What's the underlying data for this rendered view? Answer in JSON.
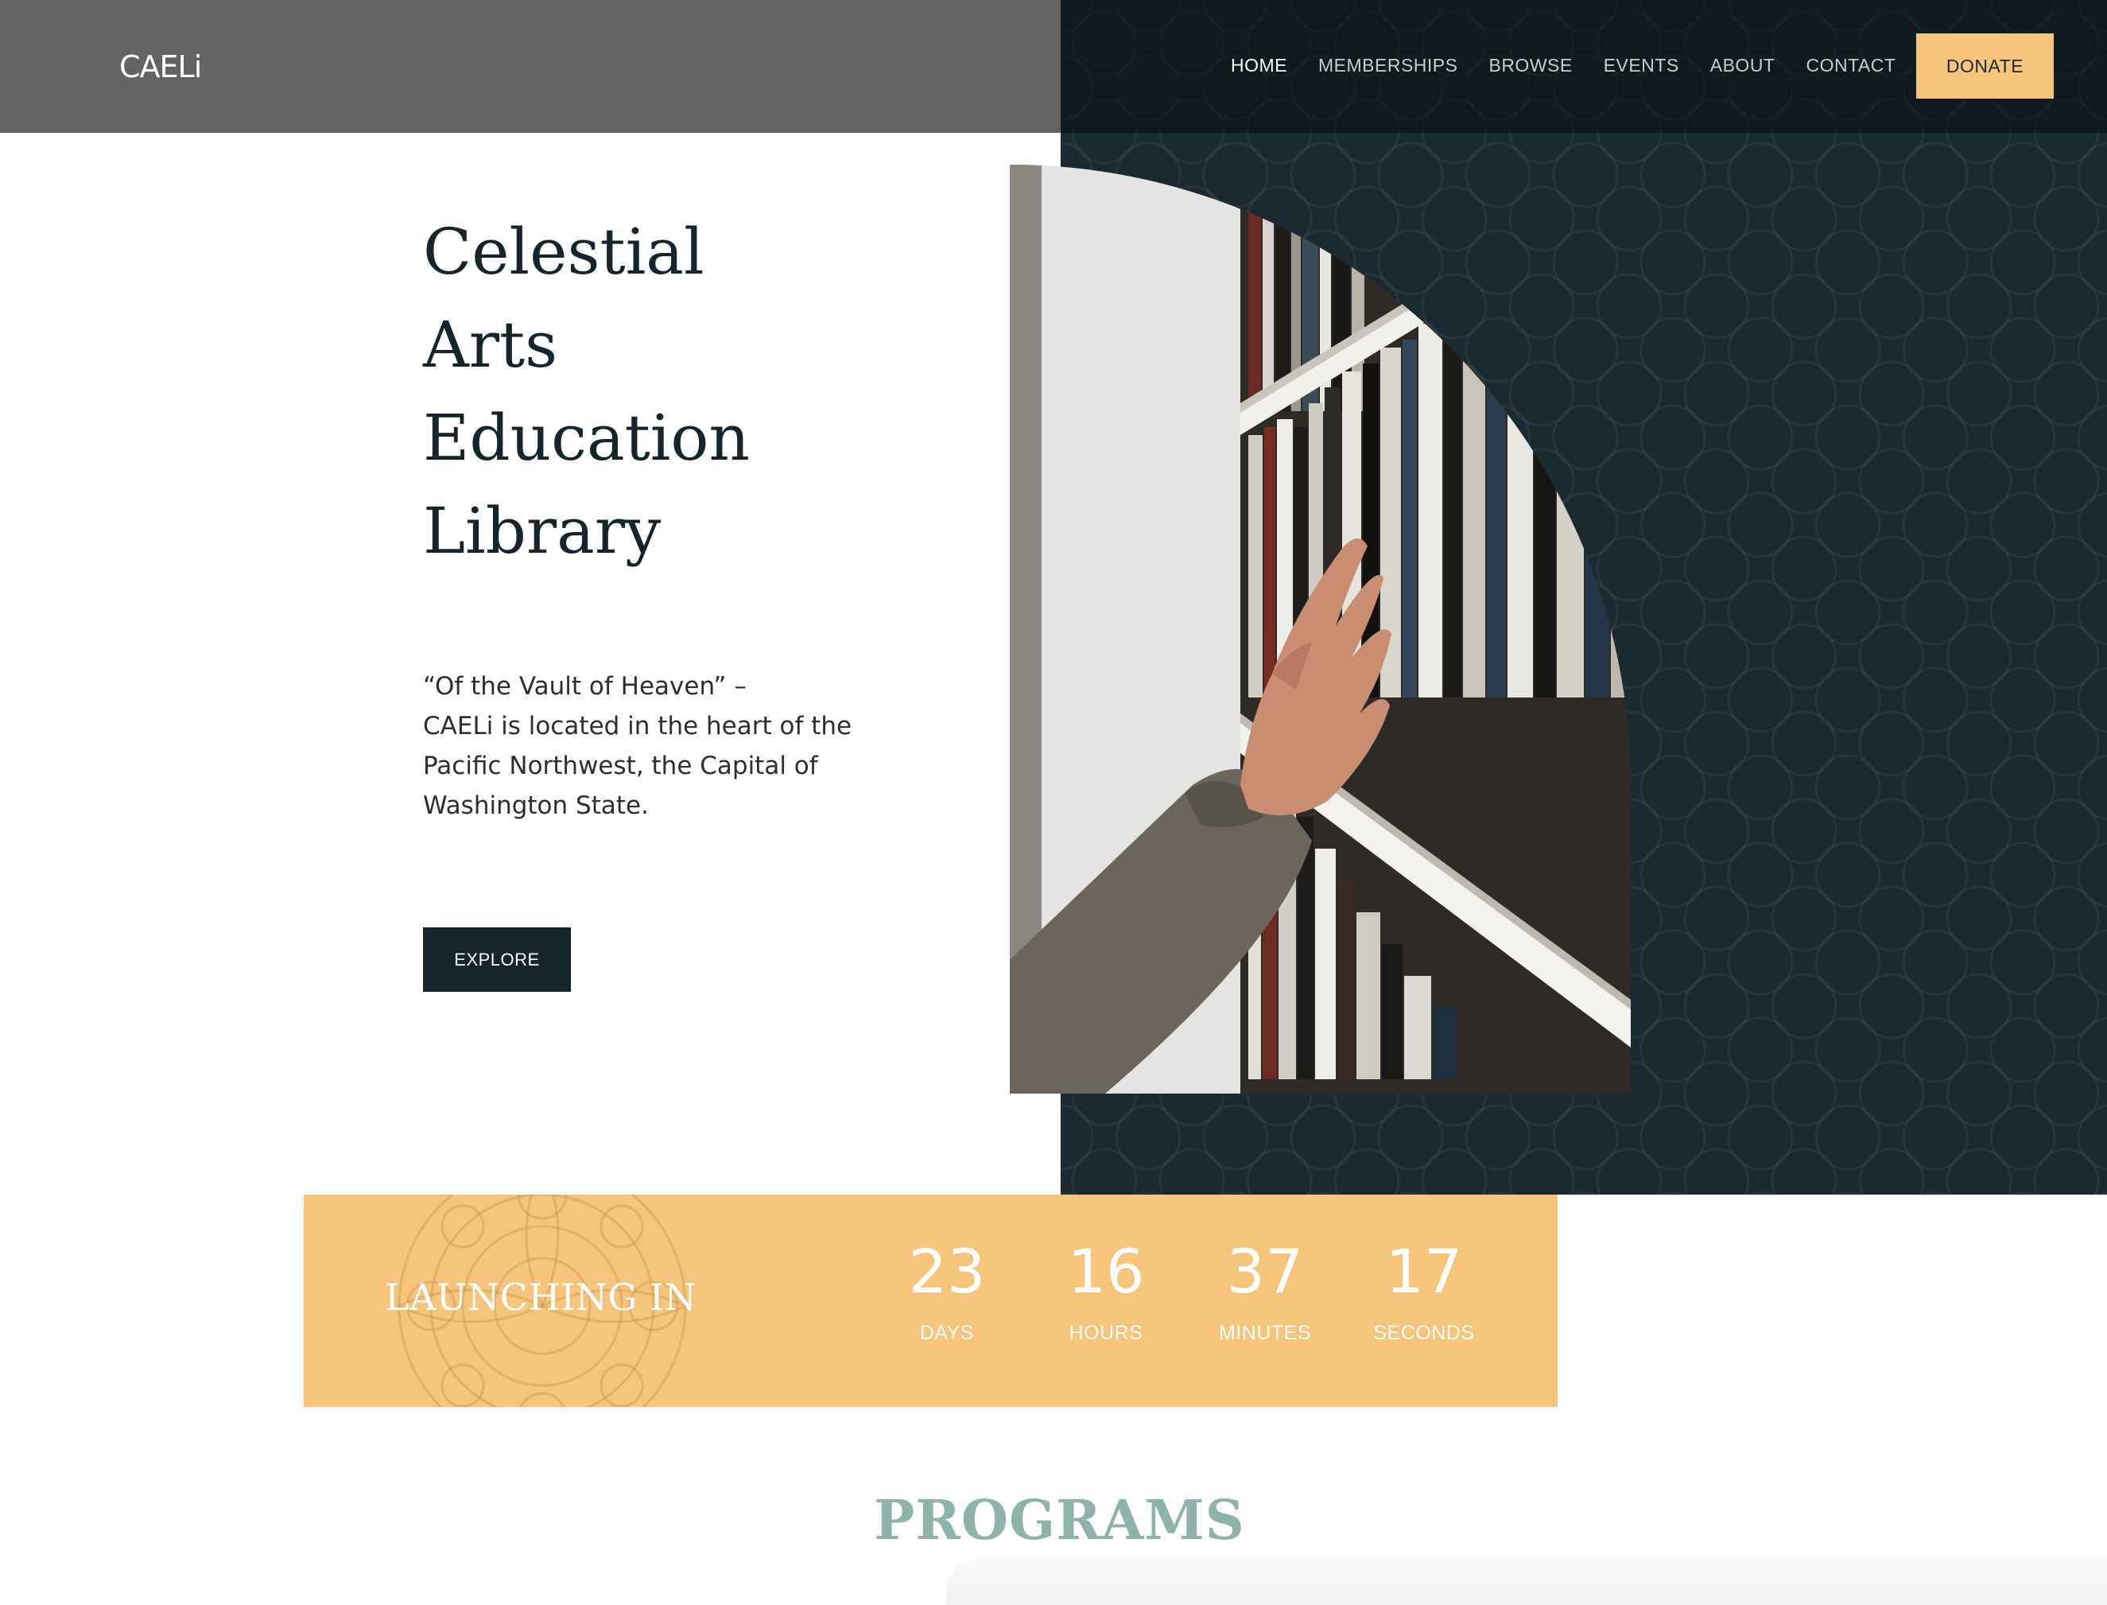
{
  "brand": {
    "name": "CAELi"
  },
  "nav": {
    "items": [
      {
        "label": "HOME",
        "active": true
      },
      {
        "label": "MEMBERSHIPS",
        "active": false
      },
      {
        "label": "BROWSE",
        "active": false
      },
      {
        "label": "EVENTS",
        "active": false
      },
      {
        "label": "ABOUT",
        "active": false
      },
      {
        "label": "CONTACT",
        "active": false
      }
    ],
    "donate_label": "DONATE"
  },
  "hero": {
    "title_lines": [
      "Celestial",
      "Arts",
      "Education",
      "Library"
    ],
    "description_lines": [
      "“Of the Vault of Heaven” –",
      "CAELi is located in the heart of the",
      "Pacific Northwest, the Capital of",
      "Washington State."
    ],
    "cta_label": "EXPLORE"
  },
  "countdown": {
    "label": "LAUNCHING IN",
    "units": [
      {
        "value": "23",
        "label": "DAYS"
      },
      {
        "value": "16",
        "label": "HOURS"
      },
      {
        "value": "37",
        "label": "MINUTES"
      },
      {
        "value": "17",
        "label": "SECONDS"
      }
    ]
  },
  "programs": {
    "title": "PROGRAMS"
  },
  "colors": {
    "header_gray": "#636363",
    "dark_panel": "#1b2a31",
    "accent_gold": "#f6c47a",
    "sage": "#8fb3aa",
    "button_dark": "#16252c"
  }
}
